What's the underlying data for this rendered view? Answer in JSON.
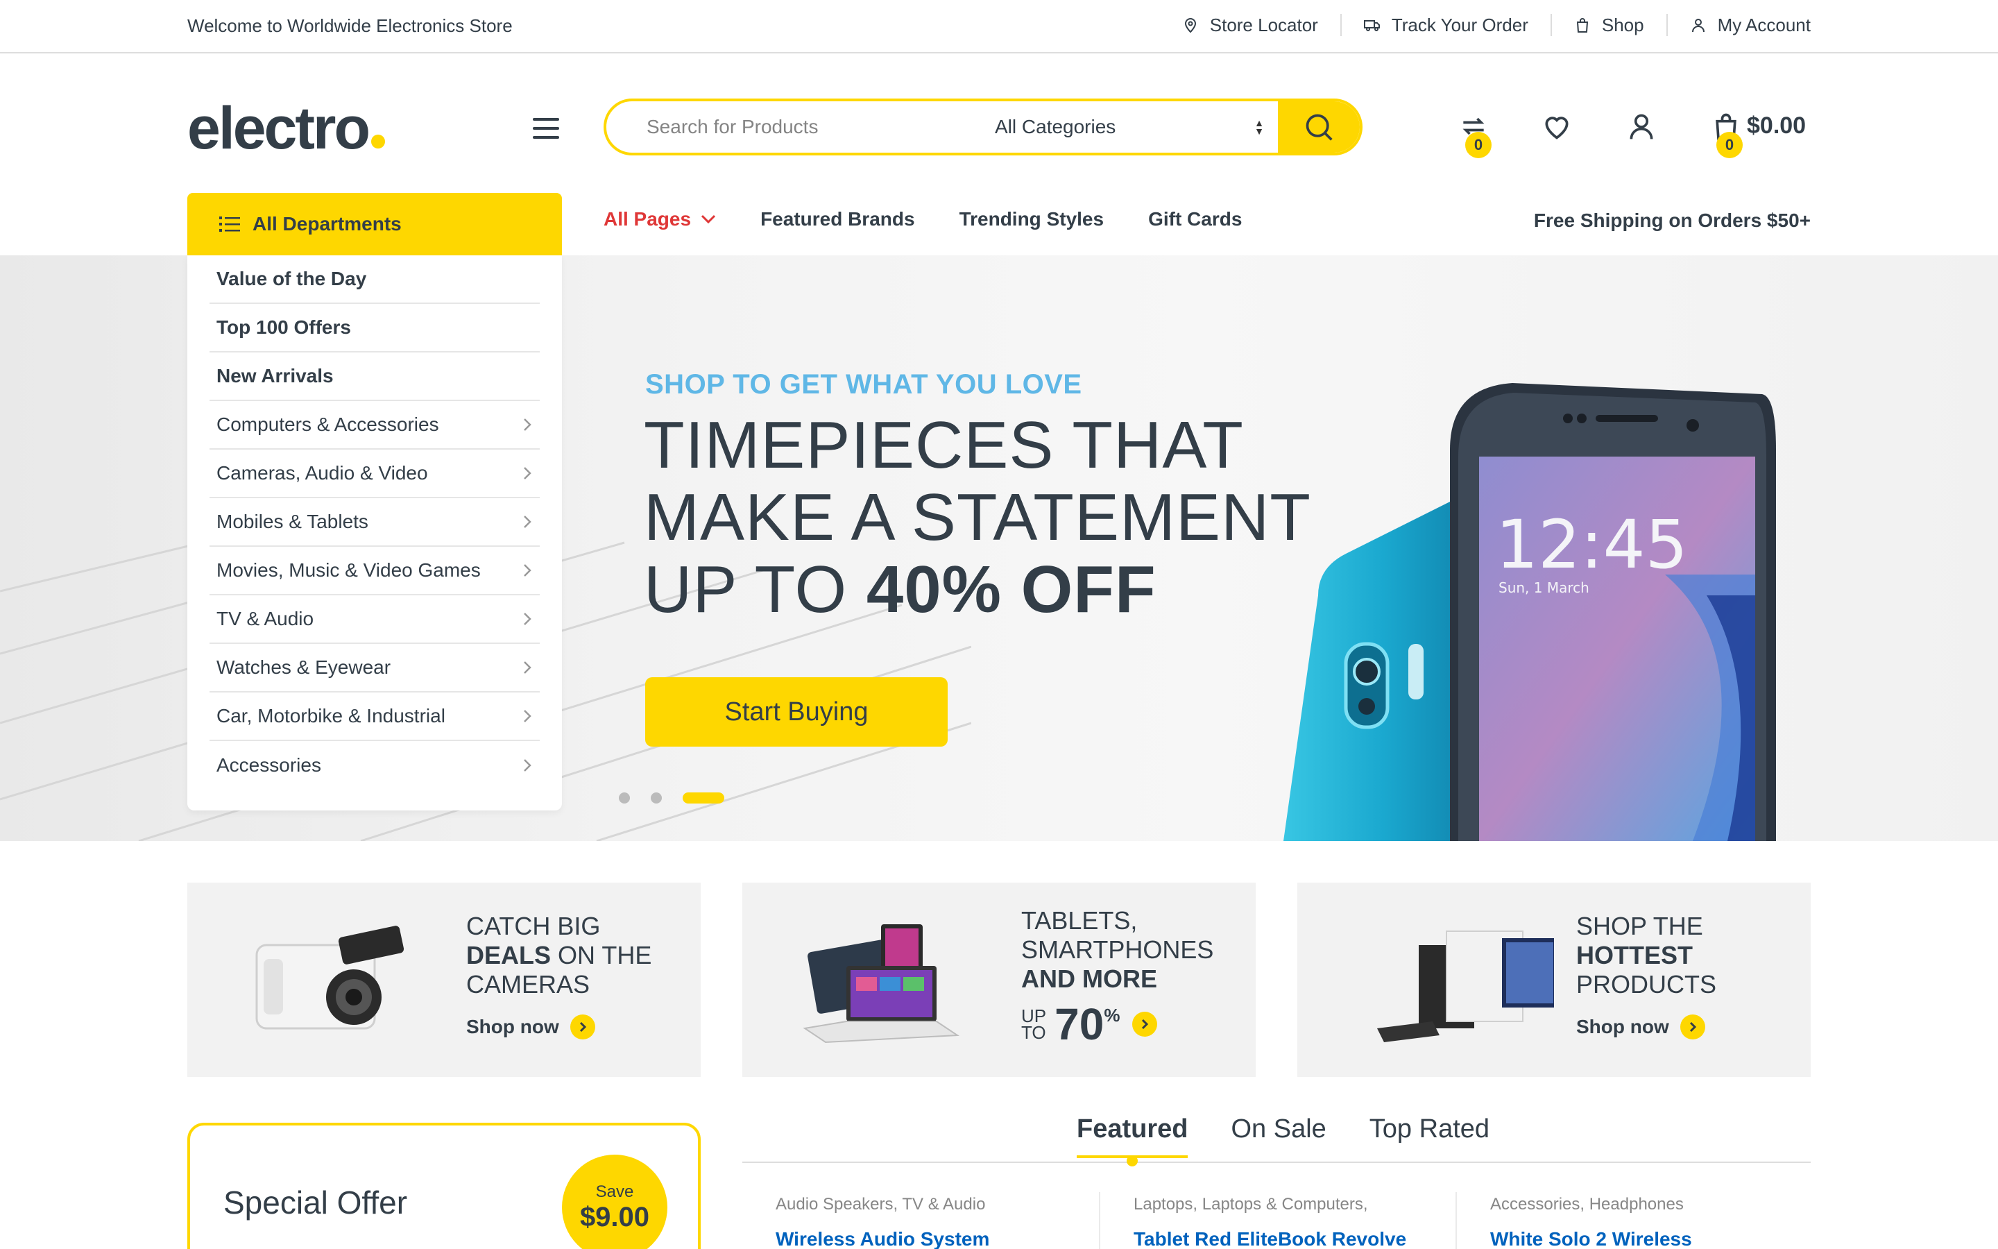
{
  "topbar": {
    "welcome": "Welcome to Worldwide Electronics Store",
    "links": [
      {
        "label": "Store Locator",
        "icon": "map-pin-icon"
      },
      {
        "label": "Track Your Order",
        "icon": "truck-icon"
      },
      {
        "label": "Shop",
        "icon": "shopping-bag-icon"
      },
      {
        "label": "My Account",
        "icon": "user-icon"
      }
    ]
  },
  "header": {
    "logo": "electro",
    "search_placeholder": "Search for Products",
    "category_select": "All Categories",
    "compare_count": "0",
    "cart_count": "0",
    "cart_total": "$0.00"
  },
  "nav": {
    "departments_label": "All Departments",
    "items": [
      "All Pages",
      "Featured Brands",
      "Trending Styles",
      "Gift Cards"
    ],
    "free_shipping": "Free Shipping on Orders $50+"
  },
  "departments": [
    {
      "label": "Value of the Day",
      "bold": true,
      "arrow": false
    },
    {
      "label": "Top 100 Offers",
      "bold": true,
      "arrow": false
    },
    {
      "label": "New Arrivals",
      "bold": true,
      "arrow": false
    },
    {
      "label": "Computers & Accessories",
      "bold": false,
      "arrow": true
    },
    {
      "label": "Cameras, Audio & Video",
      "bold": false,
      "arrow": true
    },
    {
      "label": "Mobiles & Tablets",
      "bold": false,
      "arrow": true
    },
    {
      "label": "Movies, Music & Video Games",
      "bold": false,
      "arrow": true
    },
    {
      "label": "TV & Audio",
      "bold": false,
      "arrow": true
    },
    {
      "label": "Watches & Eyewear",
      "bold": false,
      "arrow": true
    },
    {
      "label": "Car, Motorbike & Industrial",
      "bold": false,
      "arrow": true
    },
    {
      "label": "Accessories",
      "bold": false,
      "arrow": true
    }
  ],
  "hero": {
    "pretitle": "SHOP TO GET WHAT YOU LOVE",
    "line1": "TIMEPIECES THAT",
    "line2": "MAKE A STATEMENT",
    "line3_prefix": "UP TO",
    "line3_bold": "40% OFF",
    "button": "Start Buying",
    "phone_time": "12:45",
    "phone_date": "Sun, 1 March",
    "active_slide": 3,
    "slide_count": 3
  },
  "banners": [
    {
      "pre": "CATCH BIG",
      "bold": "DEALS",
      "post": "ON THE",
      "line3": "CAMERAS",
      "cta": "Shop now"
    },
    {
      "line1": "TABLETS,",
      "line2": "SMARTPHONES",
      "bold": "AND MORE",
      "up": "UP",
      "to": "TO",
      "big": "70",
      "pct": "%"
    },
    {
      "line1": "SHOP THE",
      "bold": "HOTTEST",
      "line3": "PRODUCTS",
      "cta": "Shop now"
    }
  ],
  "special_offer": {
    "title": "Special Offer",
    "save_label": "Save",
    "save_amount": "$9.00"
  },
  "product_tabs": [
    "Featured",
    "On Sale",
    "Top Rated"
  ],
  "products": [
    {
      "cat1": "Audio Speakers",
      "cat2": "TV & Audio",
      "name": "Wireless Audio System"
    },
    {
      "cat1": "Laptops",
      "cat2": "Laptops & Computers,",
      "name": "Tablet Red EliteBook Revolve"
    },
    {
      "cat1": "Accessories",
      "cat2": "Headphones",
      "name": "White Solo 2 Wireless"
    }
  ],
  "colors": {
    "accent": "#fed700",
    "text": "#333e48",
    "link": "#0062bd",
    "nav_active": "#df3737",
    "hero_pretitle": "#5fb7e6"
  }
}
